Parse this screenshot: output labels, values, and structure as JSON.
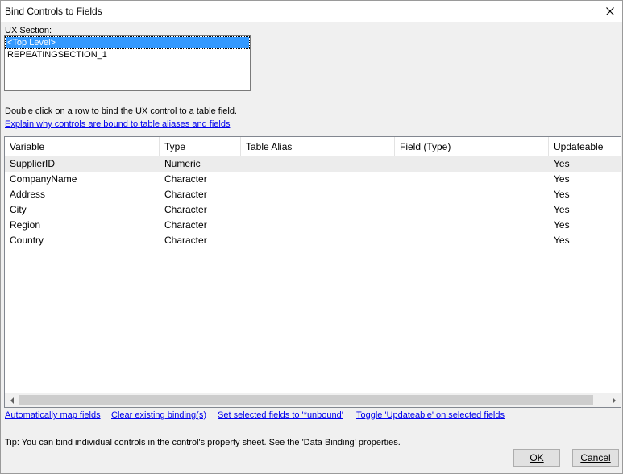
{
  "window": {
    "title": "Bind Controls to Fields"
  },
  "ux_section": {
    "label": "UX Section:",
    "items": [
      "<Top Level>",
      "REPEATINGSECTION_1"
    ],
    "selected_index": 0
  },
  "instruction": "Double click on a row to bind the UX control to a table field.",
  "explain_link": "Explain why controls are bound to table aliases and fields",
  "grid": {
    "columns": [
      "Variable",
      "Type",
      "Table Alias",
      "Field (Type)",
      "Updateable"
    ],
    "rows": [
      [
        "SupplierID",
        "Numeric",
        "",
        "",
        "Yes"
      ],
      [
        "CompanyName",
        "Character",
        "",
        "",
        "Yes"
      ],
      [
        "Address",
        "Character",
        "",
        "",
        "Yes"
      ],
      [
        "City",
        "Character",
        "",
        "",
        "Yes"
      ],
      [
        "Region",
        "Character",
        "",
        "",
        "Yes"
      ],
      [
        "Country",
        "Character",
        "",
        "",
        "Yes"
      ]
    ],
    "selected_row": 0
  },
  "links": {
    "auto_map": "Automatically map fields",
    "clear_bindings": "Clear existing binding(s)",
    "set_unbound": "Set selected fields to '*unbound'",
    "toggle_updateable": "Toggle 'Updateable' on selected fields"
  },
  "tip": "Tip: You can bind individual controls in the control's property sheet. See the 'Data Binding' properties.",
  "buttons": {
    "ok": "OK",
    "cancel": "Cancel"
  }
}
